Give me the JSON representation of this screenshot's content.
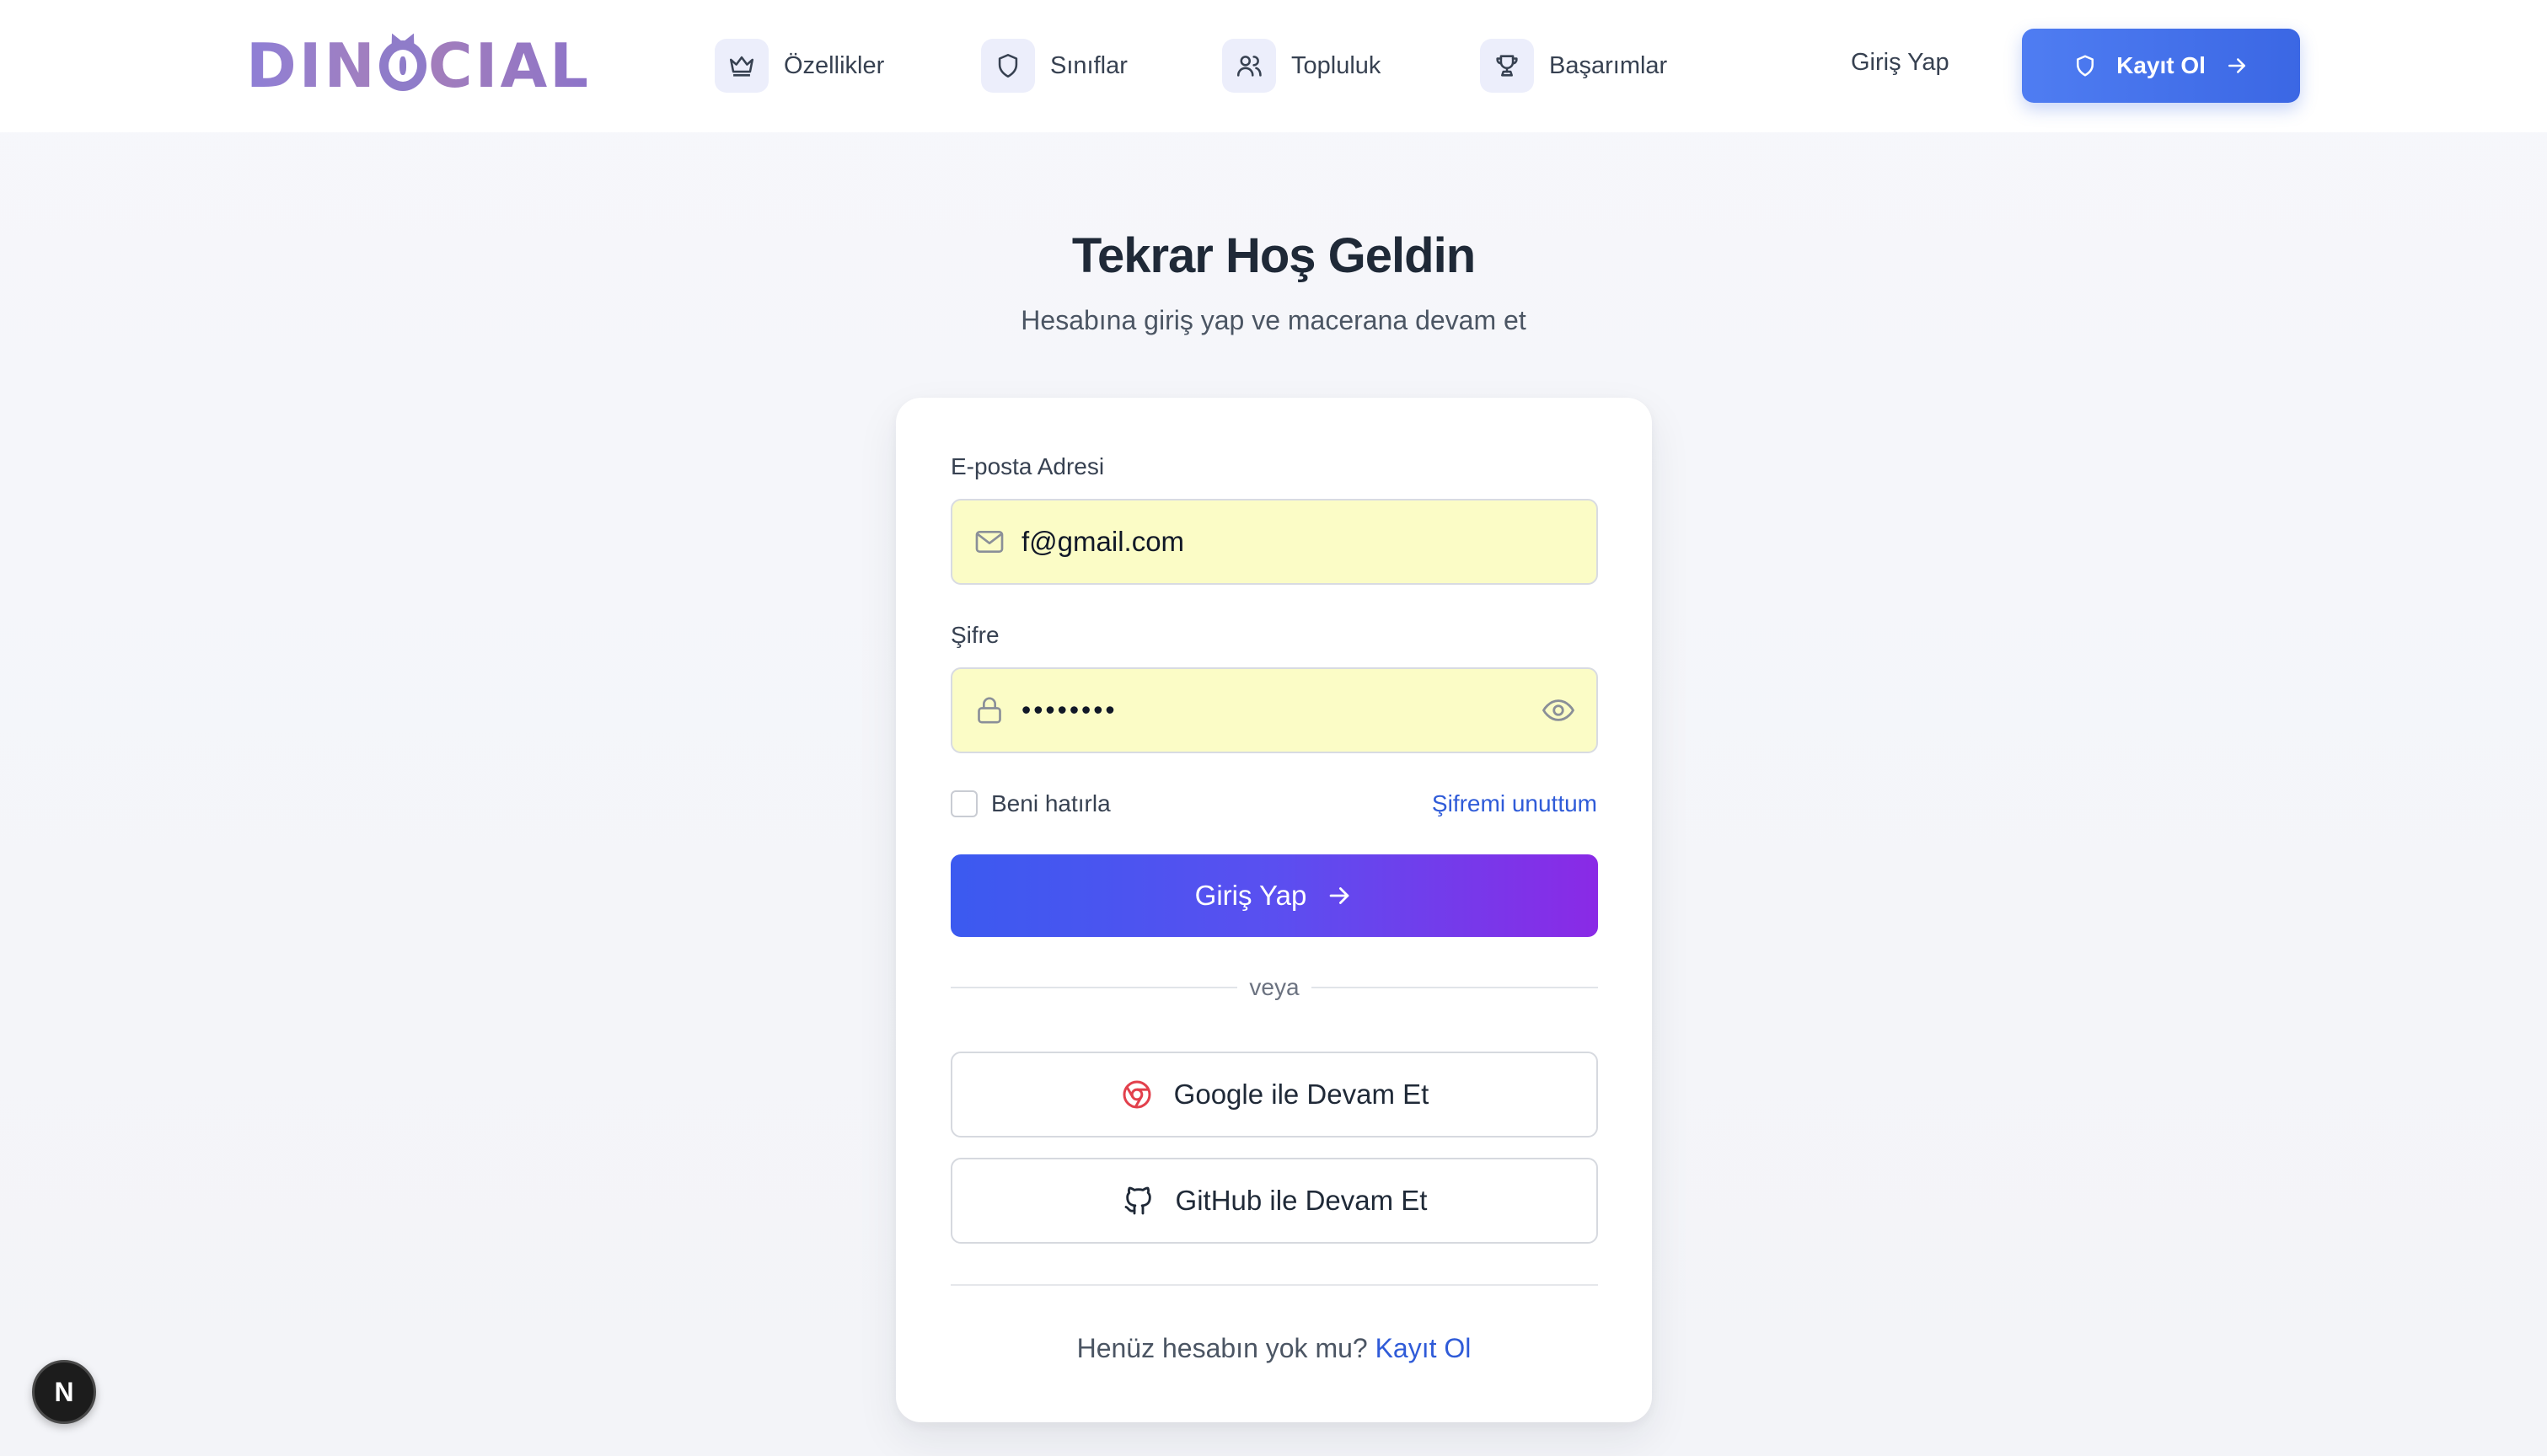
{
  "brand": {
    "logo_left": "DIN",
    "logo_right": "CIAL"
  },
  "nav": {
    "items": [
      {
        "label": "Özellikler",
        "icon": "crown-icon"
      },
      {
        "label": "Sınıflar",
        "icon": "shield-icon"
      },
      {
        "label": "Topluluk",
        "icon": "users-icon"
      },
      {
        "label": "Başarımlar",
        "icon": "trophy-icon"
      }
    ],
    "login_label": "Giriş Yap",
    "signup_label": "Kayıt Ol"
  },
  "hero": {
    "title": "Tekrar Hoş Geldin",
    "subtitle": "Hesabına giriş yap ve macerana devam et"
  },
  "form": {
    "email_label": "E-posta Adresi",
    "email_value": "f@gmail.com",
    "password_label": "Şifre",
    "password_value": "••••••••",
    "remember_label": "Beni hatırla",
    "forgot_label": "Şifremi unuttum",
    "submit_label": "Giriş Yap",
    "divider_label": "veya",
    "google_label": "Google ile Devam Et",
    "github_label": "GitHub ile Devam Et",
    "no_account_text": "Henüz hesabın yok mu?",
    "signup_link": "Kayıt Ol"
  },
  "badge": {
    "letter": "N"
  },
  "colors": {
    "accent": "#3b67e4",
    "gradient_start": "#3b5af0",
    "gradient_end": "#8a2ae6",
    "autofill": "#fbfcc6",
    "link": "#2f5bd8"
  }
}
